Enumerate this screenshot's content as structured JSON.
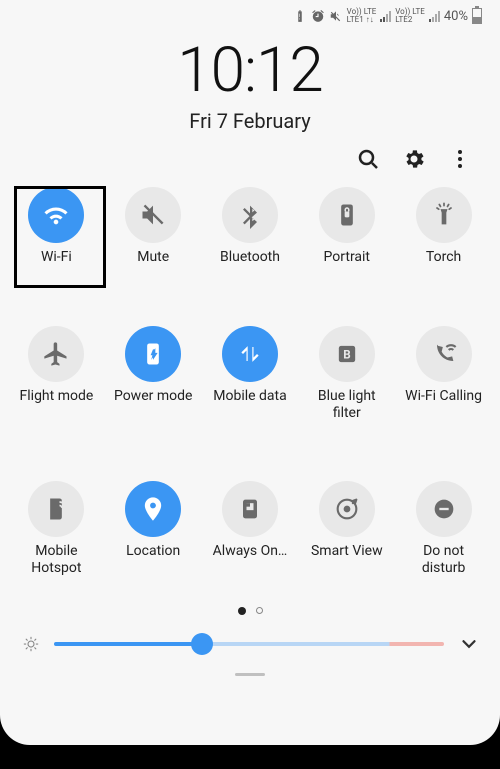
{
  "status": {
    "lte1": "Vo)) LTE\nLTE1 ↑↓",
    "lte2": "Vo)) LTE\nLTE2",
    "battery_pct": "40%"
  },
  "clock": "10:12",
  "date": "Fri 7 February",
  "tiles": [
    {
      "id": "wifi",
      "label": "Wi-Fi",
      "on": true
    },
    {
      "id": "mute",
      "label": "Mute",
      "on": false
    },
    {
      "id": "bluetooth",
      "label": "Bluetooth",
      "on": false
    },
    {
      "id": "portrait",
      "label": "Portrait",
      "on": false
    },
    {
      "id": "torch",
      "label": "Torch",
      "on": false
    },
    {
      "id": "flight",
      "label": "Flight mode",
      "on": false
    },
    {
      "id": "power",
      "label": "Power mode",
      "on": true
    },
    {
      "id": "mobiledata",
      "label": "Mobile data",
      "on": true
    },
    {
      "id": "bluefilter",
      "label": "Blue light filter",
      "on": false
    },
    {
      "id": "wificalling",
      "label": "Wi-Fi Calling",
      "on": false
    },
    {
      "id": "hotspot",
      "label": "Mobile Hotspot",
      "on": false
    },
    {
      "id": "location",
      "label": "Location",
      "on": true
    },
    {
      "id": "alwayson",
      "label": "Always On…",
      "on": false
    },
    {
      "id": "smartview",
      "label": "Smart View",
      "on": false
    },
    {
      "id": "dnd",
      "label": "Do not disturb",
      "on": false
    }
  ],
  "pager": {
    "current": 0,
    "total": 2
  },
  "brightness_pct": 38
}
